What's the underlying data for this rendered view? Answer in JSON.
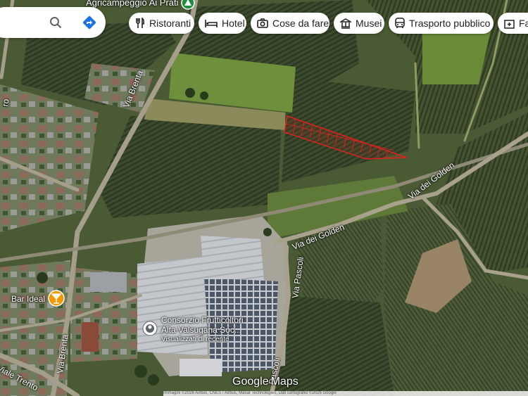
{
  "search": {
    "search_icon": "search-icon",
    "directions_icon": "directions-icon"
  },
  "chips": [
    {
      "label": "Ristoranti",
      "icon": "fork-knife-icon"
    },
    {
      "label": "Hotel",
      "icon": "bed-icon"
    },
    {
      "label": "Cose da fare",
      "icon": "camera-icon"
    },
    {
      "label": "Musei",
      "icon": "museum-icon"
    },
    {
      "label": "Trasporto pubblico",
      "icon": "bus-icon"
    },
    {
      "label": "Far",
      "icon": "pharmacy-icon"
    }
  ],
  "top_poi": "Agricampeggio Ai Prati",
  "roads": {
    "via_brenta_north": "Via Brenta",
    "via_brenta_south": "Via Brenta",
    "via_dei_golden_east": "Via dei Golden",
    "via_dei_golden_west": "Via dei Golden",
    "via_pascoli_north": "Via Pascoli",
    "via_pascoli_south": "Pascoli",
    "viale_trento": "Viale Trento",
    "left_edge": "ro"
  },
  "pois": {
    "bar": {
      "name": "Bar Ideal",
      "icon": "cocktail-icon",
      "color": "#f29900"
    },
    "consorzio": {
      "line1": "Consorzio Frutticoltori",
      "line2": "Alta Valsugana Soc...",
      "line3": "Visualizzati di recente",
      "icon": "recent-pin-icon"
    }
  },
  "branding": {
    "google": "Google",
    "maps": "Maps"
  },
  "footer": "Immagini ©2026 Airbus, CNES / Airbus, Maxar Technologies, Dati cartografici ©2026 Google",
  "colors": {
    "parcel_outline": "#e0221f",
    "fields": "#3d4a2c",
    "grass": "#6b8a3a",
    "roof": "#c9ccd0",
    "road": "#a7a08e"
  }
}
